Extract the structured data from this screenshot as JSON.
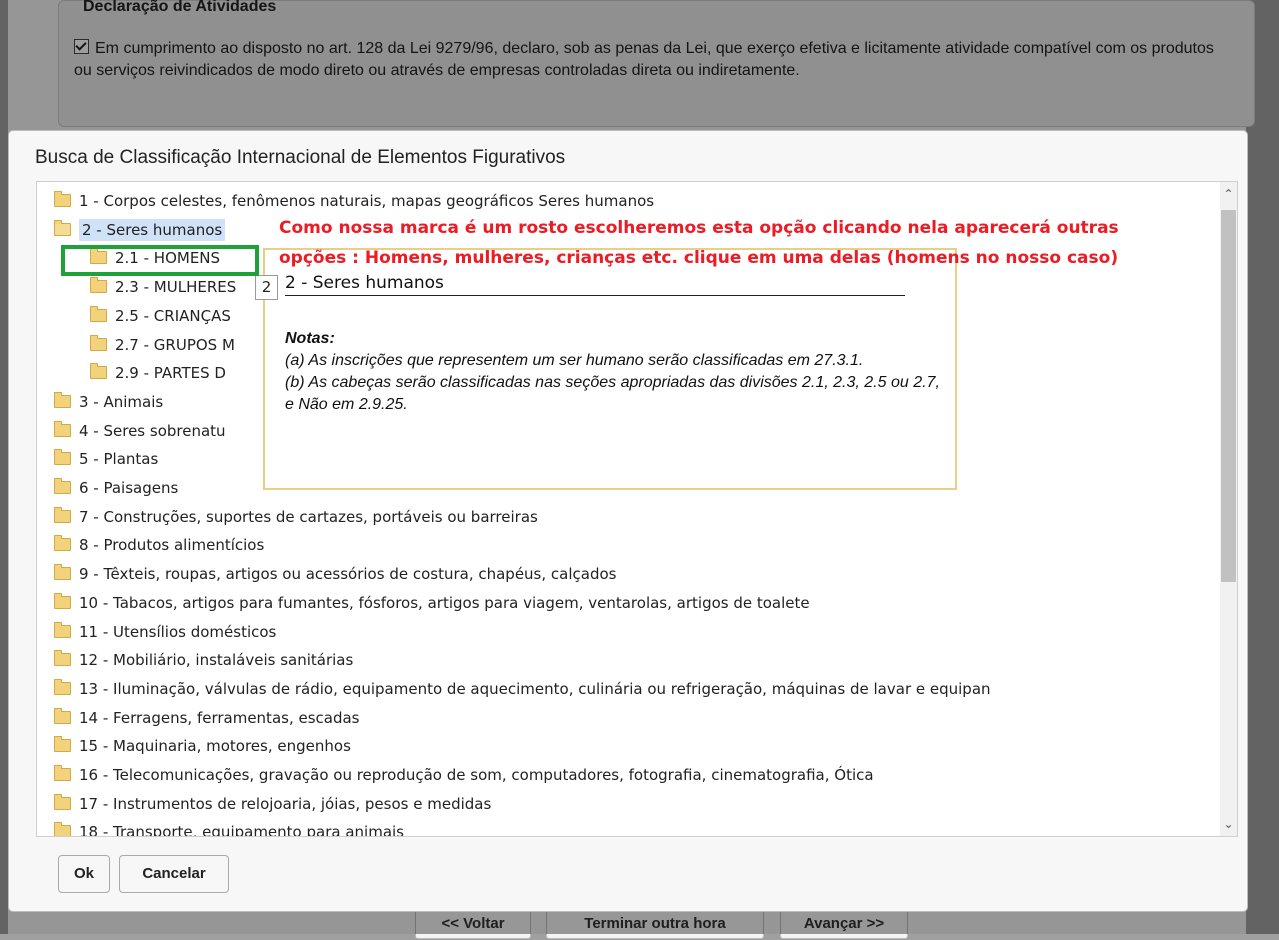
{
  "background": {
    "declaration_title": "Declaração de Atividades",
    "declaration_text": "Em cumprimento ao disposto no art. 128 da Lei 9279/96, declaro, sob as penas da Lei, que exerço efetiva e licitamente atividade compatível com os produtos ou serviços reivindicados de modo direto ou através de empresas controladas direta ou indiretamente.",
    "footer_buttons": [
      "<< Voltar",
      "Terminar outra hora",
      "Avançar >>"
    ]
  },
  "dialog": {
    "title": "Busca de Classificação Internacional de Elementos Figurativos",
    "tree": [
      {
        "label": "1 - Corpos celestes, fenômenos naturais, mapas geográficos Seres humanos",
        "level": 0
      },
      {
        "label": "2 - Seres humanos",
        "level": 0,
        "open": true,
        "selected": true
      },
      {
        "label": "2.1 - HOMENS",
        "level": 1
      },
      {
        "label": "2.3 - MULHERES",
        "level": 1
      },
      {
        "label": "2.5 - CRIANÇAS",
        "level": 1
      },
      {
        "label": "2.7 - GRUPOS M",
        "level": 1
      },
      {
        "label": "2.9 - PARTES D",
        "level": 1
      },
      {
        "label": "3 - Animais",
        "level": 0
      },
      {
        "label": "4 - Seres sobrenatu",
        "level": 0
      },
      {
        "label": "5 - Plantas",
        "level": 0
      },
      {
        "label": "6 - Paisagens",
        "level": 0
      },
      {
        "label": "7 - Construções, suportes de cartazes, portáveis ou barreiras",
        "level": 0
      },
      {
        "label": "8 - Produtos alimentícios",
        "level": 0
      },
      {
        "label": "9 - Têxteis, roupas, artigos ou acessórios de costura, chapéus, calçados",
        "level": 0
      },
      {
        "label": "10 - Tabacos, artigos para fumantes, fósforos, artigos para viagem, ventarolas, artigos de toalete",
        "level": 0
      },
      {
        "label": "11 - Utensílios domésticos",
        "level": 0
      },
      {
        "label": "12 - Mobiliário, instaláveis sanitárias",
        "level": 0
      },
      {
        "label": "13 - Iluminação, válvulas de rádio, equipamento de aquecimento, culinária ou refrigeração, máquinas de lavar e equipan",
        "level": 0
      },
      {
        "label": "14 - Ferragens, ferramentas, escadas",
        "level": 0
      },
      {
        "label": "15 - Maquinaria, motores, engenhos",
        "level": 0
      },
      {
        "label": "16 - Telecomunicações, gravação ou reprodução de som, computadores, fotografia, cinematografia, Ótica",
        "level": 0
      },
      {
        "label": "17 - Instrumentos de relojoaria, jóias, pesos e medidas",
        "level": 0
      },
      {
        "label": "18 - Transporte, equipamento para animais",
        "level": 0
      }
    ],
    "tooltip": {
      "number": "2",
      "title": "2 - Seres humanos",
      "notes_heading": "Notas:",
      "note_a": "(a) As inscrições que representem um ser humano serão classificadas em 27.3.1.",
      "note_b": "(b) As cabeças serão classificadas nas seções apropriadas das divisões 2.1, 2.3, 2.5 ou 2.7, e Não em 2.9.25."
    },
    "ok_label": "Ok",
    "cancel_label": "Cancelar"
  },
  "annotation": {
    "line1": "Como nossa marca é um rosto escolheremos esta opção clicando nela aparecerá outras",
    "line2": "opções : Homens, mulheres, crianças etc. clique em uma delas (homens no nosso caso)",
    "color": "#ee1b24",
    "highlight_color": "#1fa13a"
  }
}
